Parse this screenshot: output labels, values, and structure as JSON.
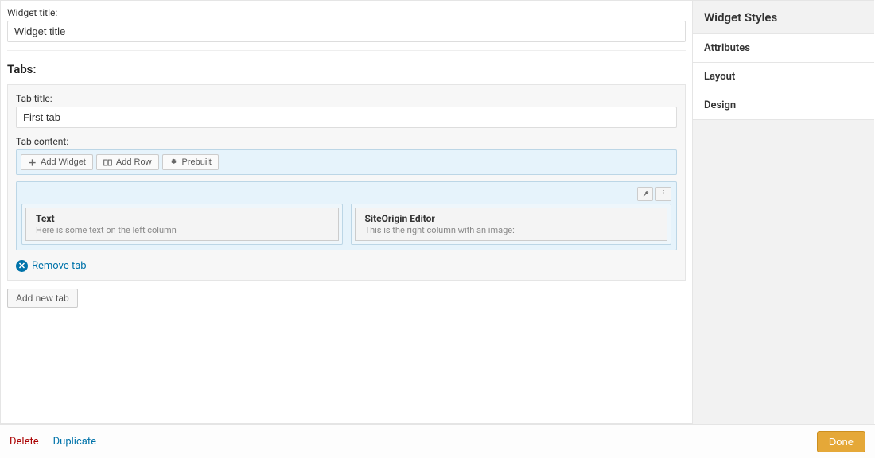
{
  "form": {
    "widget_title_label": "Widget title:",
    "widget_title_value": "Widget title",
    "tabs_heading": "Tabs:",
    "tab_title_label": "Tab title:",
    "tab_title_value": "First tab",
    "tab_content_label": "Tab content:"
  },
  "toolbar": {
    "add_widget": "Add Widget",
    "add_row": "Add Row",
    "prebuilt": "Prebuilt"
  },
  "widgets": [
    {
      "title": "Text",
      "desc": "Here is some text on the left column"
    },
    {
      "title": "SiteOrigin Editor",
      "desc": "This is the right column with an image:"
    }
  ],
  "actions": {
    "remove_tab": "Remove tab",
    "add_new_tab": "Add new tab"
  },
  "sidebar": {
    "title": "Widget Styles",
    "items": [
      "Attributes",
      "Layout",
      "Design"
    ]
  },
  "footer": {
    "delete": "Delete",
    "duplicate": "Duplicate",
    "done": "Done"
  }
}
